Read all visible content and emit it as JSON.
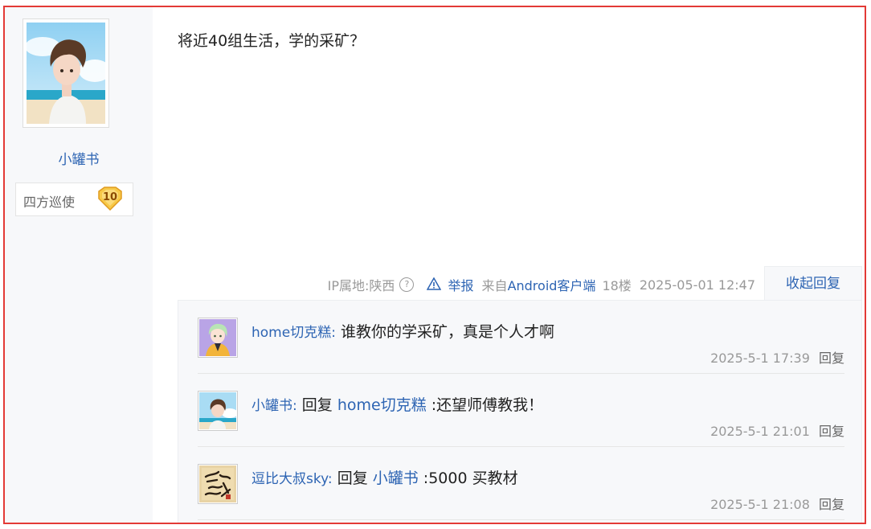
{
  "author": {
    "name": "小罐书",
    "title": "四方巡使",
    "level": "10"
  },
  "post": {
    "content": "将近40组生活，学的采矿？",
    "ip": "IP属地:陕西",
    "help_icon": "?",
    "report_label": "举报",
    "from_prefix": "来自",
    "platform": "Android客户端",
    "floor": "18楼",
    "time": "2025-05-01 12:47",
    "collapse_label": "收起回复"
  },
  "replies": [
    {
      "user": "home切克糕",
      "colon": ":",
      "prefix": "",
      "target": "",
      "text": " 谁教你的学采矿，真是个人才啊",
      "time": "2025-5-1 17:39",
      "reply_label": "回复"
    },
    {
      "user": "小罐书",
      "colon": ":",
      "prefix": " 回复 ",
      "target": "home切克糕",
      "text": " :还望师傅教我！",
      "time": "2025-5-1 21:01",
      "reply_label": "回复"
    },
    {
      "user": "逗比大叔sky",
      "colon": ":",
      "prefix": " 回复 ",
      "target": "小罐书",
      "text": " :5000 买教材",
      "time": "2025-5-1 21:08",
      "reply_label": "回复"
    }
  ],
  "colors": {
    "link": "#2d64b3",
    "frame": "#e33a36",
    "muted": "#999999"
  }
}
